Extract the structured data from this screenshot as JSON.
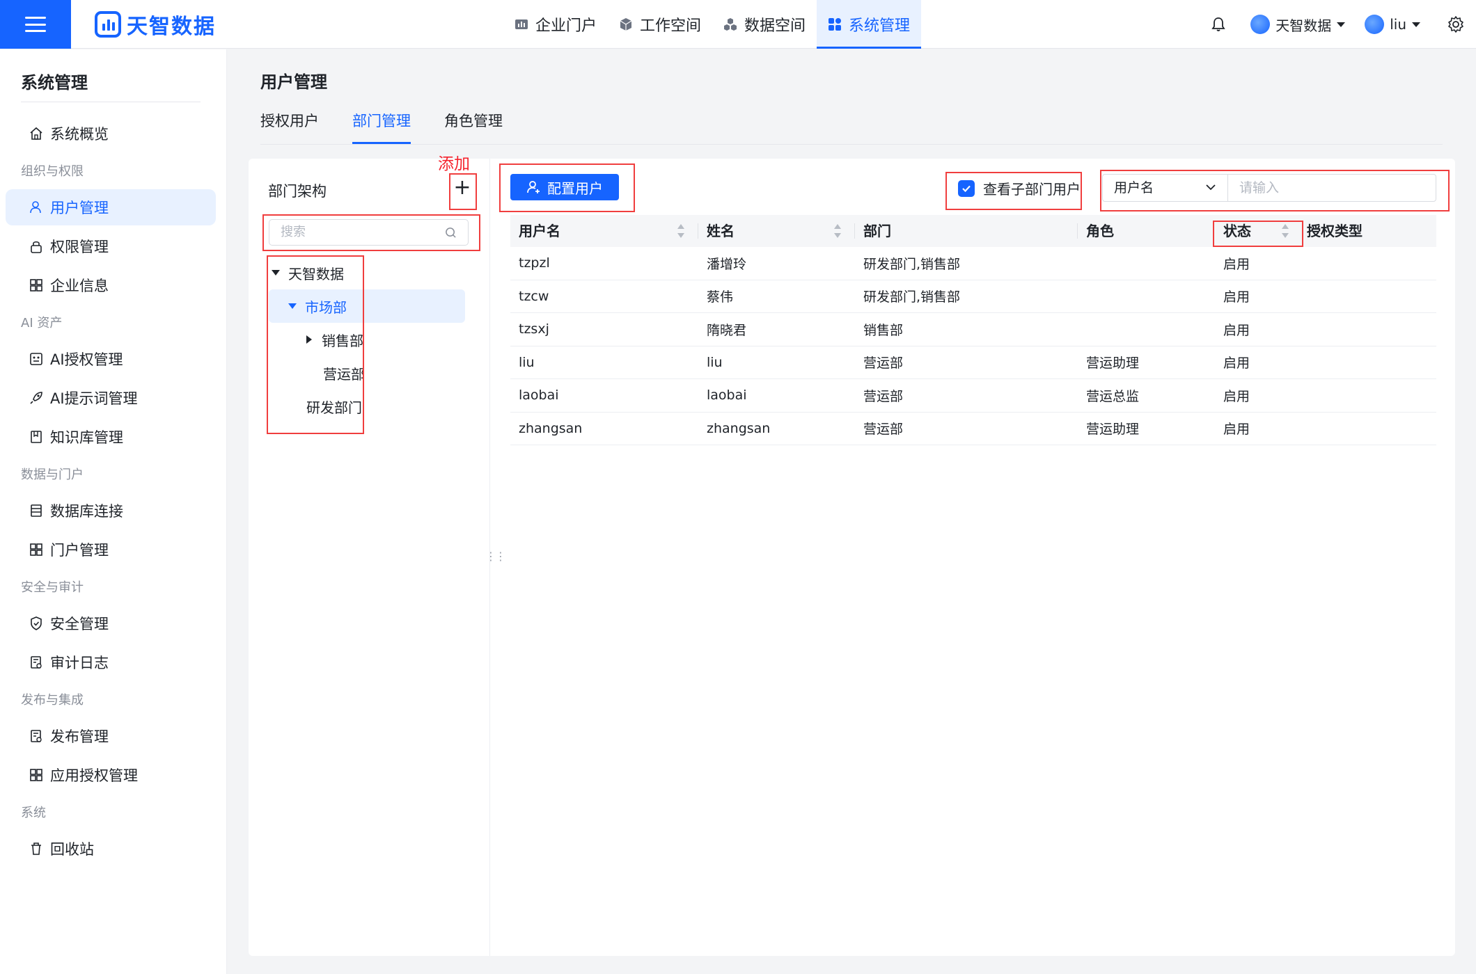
{
  "app": {
    "logo_text": "天智数据",
    "brand_color": "#1664ff"
  },
  "topnav": {
    "items": [
      {
        "label": "企业门户",
        "icon": "chart-icon"
      },
      {
        "label": "工作空间",
        "icon": "cube-icon"
      },
      {
        "label": "数据空间",
        "icon": "cubes-icon"
      },
      {
        "label": "系统管理",
        "icon": "grid-icon",
        "active": true
      }
    ],
    "org_label": "天智数据",
    "user_label": "liu"
  },
  "sidebar": {
    "title": "系统管理",
    "overview": "系统概览",
    "groups": [
      {
        "label": "组织与权限",
        "items": [
          "用户管理",
          "权限管理",
          "企业信息"
        ]
      },
      {
        "label": "AI 资产",
        "items": [
          "AI授权管理",
          "AI提示词管理",
          "知识库管理"
        ]
      },
      {
        "label": "数据与门户",
        "items": [
          "数据库连接",
          "门户管理"
        ]
      },
      {
        "label": "安全与审计",
        "items": [
          "安全管理",
          "审计日志"
        ]
      },
      {
        "label": "发布与集成",
        "items": [
          "发布管理",
          "应用授权管理"
        ]
      },
      {
        "label": "系统",
        "items": [
          "回收站"
        ]
      }
    ],
    "active_item": "用户管理"
  },
  "main": {
    "title": "用户管理",
    "tabs": [
      "授权用户",
      "部门管理",
      "角色管理"
    ],
    "active_tab": "部门管理"
  },
  "dept_panel": {
    "title": "部门架构",
    "add_annotation": "添加",
    "add_symbol": "+",
    "search_placeholder": "搜索",
    "tree": {
      "root": "天智数据",
      "selected": "市场部",
      "child": "销售部",
      "grandchild": "营运部",
      "sibling": "研发部门"
    }
  },
  "user_panel": {
    "config_button": "配置用户",
    "checkbox_label": "查看子部门用户",
    "checkbox_checked": true,
    "filter_field": "用户名",
    "filter_placeholder": "请输入",
    "columns": [
      "用户名",
      "姓名",
      "部门",
      "角色",
      "状态",
      "授权类型"
    ],
    "rows": [
      [
        "tzpzl",
        "潘增玲",
        "研发部门,销售部",
        "",
        "启用",
        ""
      ],
      [
        "tzcw",
        "蔡伟",
        "研发部门,销售部",
        "",
        "启用",
        ""
      ],
      [
        "tzsxj",
        "隋晓君",
        "销售部",
        "",
        "启用",
        ""
      ],
      [
        "liu",
        "liu",
        "营运部",
        "营运助理",
        "启用",
        ""
      ],
      [
        "laobai",
        "laobai",
        "营运部",
        "营运总监",
        "启用",
        ""
      ],
      [
        "zhangsan",
        "zhangsan",
        "营运部",
        "营运助理",
        "启用",
        ""
      ]
    ]
  },
  "annotation_color": "#f03e3e"
}
